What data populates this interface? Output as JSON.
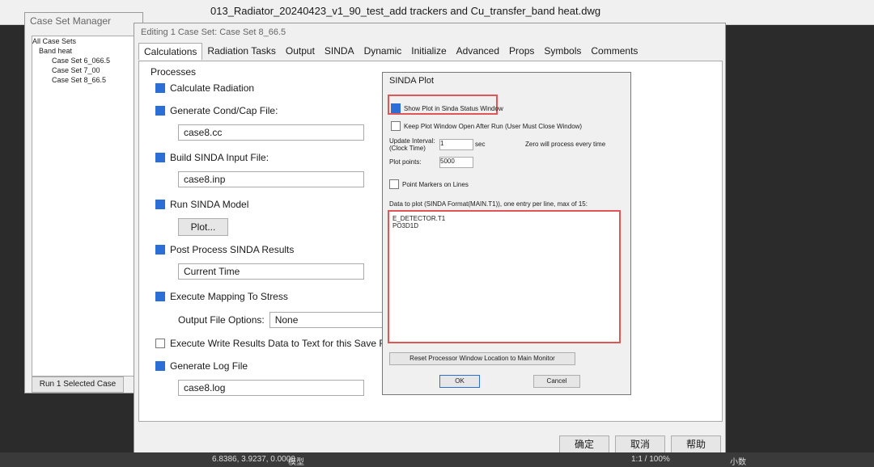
{
  "window": {
    "title": "013_Radiator_20240423_v1_90_test_add trackers and Cu_transfer_band heat.dwg"
  },
  "case_set_manager": {
    "title": "Case Set Manager",
    "tree": [
      "All Case Sets",
      "Band heat",
      "Case Set 6_066.5",
      "Case Set 7_00",
      "Case Set 8_66.5"
    ],
    "run_label": "Run 1 Selected Case"
  },
  "edit": {
    "title": "Editing 1 Case Set: Case Set 8_66.5",
    "tabs": [
      "Calculations",
      "Radiation Tasks",
      "Output",
      "SINDA",
      "Dynamic",
      "Initialize",
      "Advanced",
      "Props",
      "Symbols",
      "Comments"
    ],
    "processes": "Processes",
    "calc_radiation": "Calculate Radiation",
    "gen_condcap": "Generate Cond/Cap File:",
    "condcap_file": "case8.cc",
    "build_sinda": "Build SINDA Input File:",
    "sinda_file": "case8.inp",
    "run_sinda": "Run SINDA Model",
    "plot_label": "Plot...",
    "post_process": "Post Process SINDA Results",
    "time_select": "Current Time",
    "exec_mapping": "Execute Mapping To Stress",
    "output_opts": "Output File Options:",
    "output_val": "None",
    "exec_write": "Execute Write Results Data to Text for this Save File",
    "gen_log": "Generate Log File",
    "log_file": "case8.log",
    "ok_label": "确定",
    "cancel_label": "取消",
    "help_label": "帮助"
  },
  "sinda": {
    "title": "SINDA Plot",
    "show_plot": "Show Plot in Sinda Status Window",
    "keep_open": "Keep Plot Window Open After Run (User Must Close Window)",
    "update_label": "Update Interval: (Clock Time)",
    "update_val": "1",
    "update_unit": "sec",
    "zero_note": "Zero will process every time",
    "plot_points_label": "Plot points:",
    "plot_points_val": "5000",
    "markers": "Point Markers on Lines",
    "data_label": "Data to plot (SINDA Format(MAIN.T1)), one entry per line, max of 15:",
    "entries": [
      "E_DETECTOR.T1",
      "PO3D1D"
    ],
    "reset_label": "Reset Processor Window Location to Main Monitor",
    "ok": "OK",
    "cancel": "Cancel"
  },
  "footer": {
    "coords": "6.8386, 3.9237, 0.0000",
    "mode": "模型",
    "scale": "1:1 / 100%",
    "units": "小数"
  }
}
